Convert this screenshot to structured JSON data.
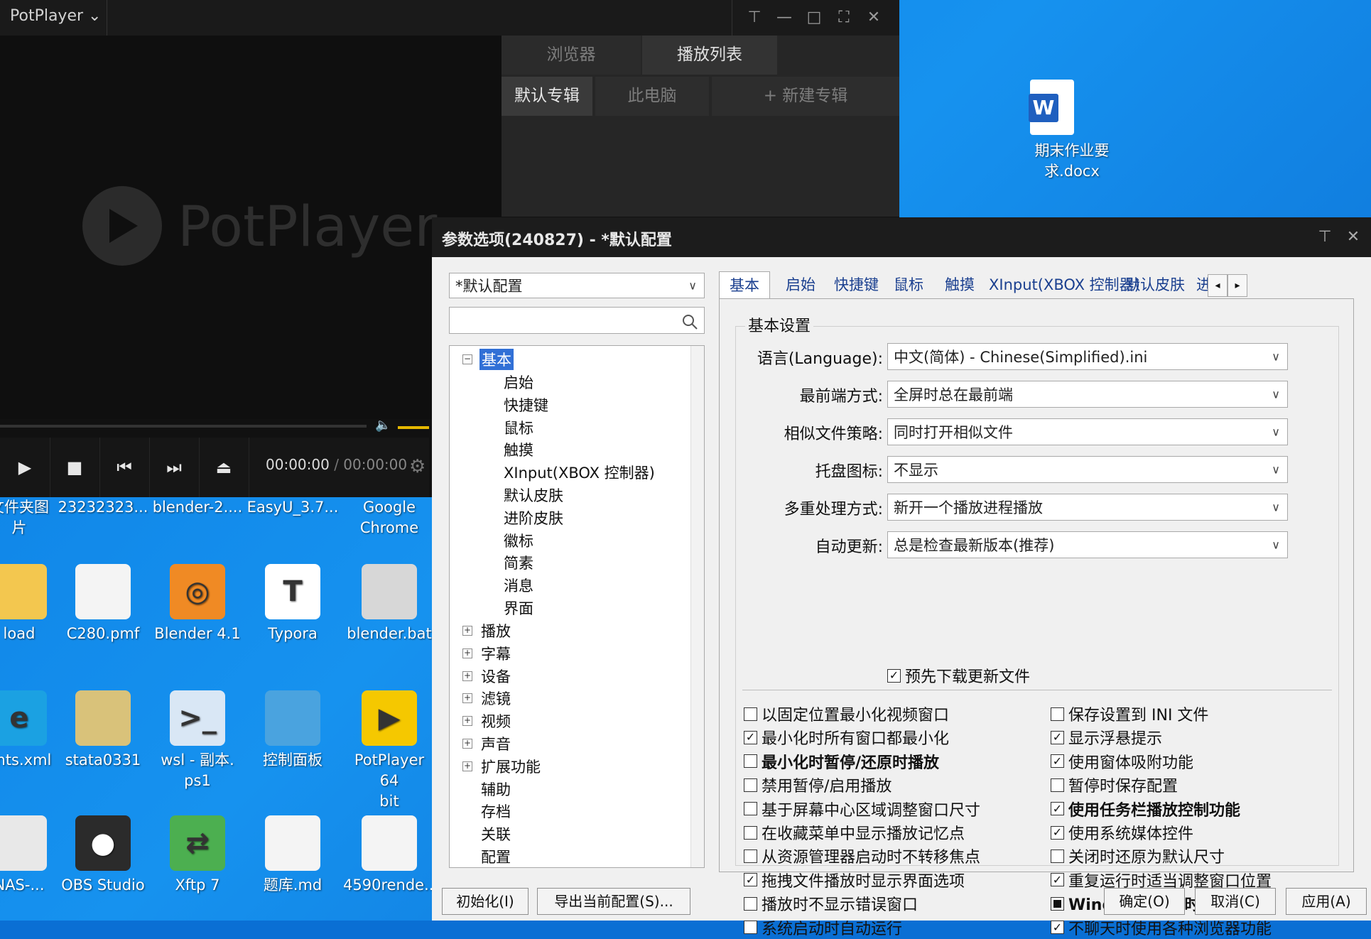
{
  "potplayer": {
    "app_name": "PotPlayer ⌄",
    "window_controls": [
      "⊤",
      "—",
      "□",
      "⛶",
      "✕"
    ],
    "browser_tab": "浏览器",
    "playlist_tab": "播放列表",
    "sub_tabs": [
      "默认专辑",
      "此电脑",
      "+ 新建专辑"
    ],
    "logo_text": "PotPlayer",
    "time_current": "00:00:00",
    "time_sep": "/",
    "time_total": "00:00:00"
  },
  "desktop": {
    "word_file": "期末作业要\n求.docx",
    "icons": [
      {
        "label": "文件夹图\n片",
        "icon": "folder-icon"
      },
      {
        "label": "23232323...",
        "icon": "file-icon"
      },
      {
        "label": "blender-2....",
        "icon": "archive-icon"
      },
      {
        "label": "EasyU_3.7...",
        "icon": "app-icon"
      },
      {
        "label": "Google\nChrome",
        "icon": "chrome-icon"
      },
      {
        "label": "load",
        "icon": "folder-icon"
      },
      {
        "label": "C280.pmf",
        "icon": "file-icon"
      },
      {
        "label": "Blender 4.1",
        "icon": "blender-icon"
      },
      {
        "label": "Typora",
        "icon": "typora-icon"
      },
      {
        "label": "blender.bat",
        "icon": "bat-icon"
      },
      {
        "label": "ents.xml",
        "icon": "edge-icon"
      },
      {
        "label": "stata0331",
        "icon": "archive-icon"
      },
      {
        "label": "wsl - 副本.\nps1",
        "icon": "powershell-icon"
      },
      {
        "label": "控制面板",
        "icon": "control-panel-icon"
      },
      {
        "label": "PotPlayer 64\nbit",
        "icon": "potplayer-icon"
      },
      {
        "label": "NAS-...",
        "icon": "nas-icon"
      },
      {
        "label": "OBS Studio",
        "icon": "obs-icon"
      },
      {
        "label": "Xftp 7",
        "icon": "xftp-icon"
      },
      {
        "label": "题库.md",
        "icon": "file-icon"
      },
      {
        "label": "4590rende...",
        "icon": "file-icon"
      }
    ]
  },
  "dialog": {
    "title": "参数选项(240827) - *默认配置",
    "profile_value": "*默认配置",
    "tree": {
      "root": "基本",
      "children": [
        "启始",
        "快捷键",
        "鼠标",
        "触摸",
        "XInput(XBOX 控制器)",
        "默认皮肤",
        "进阶皮肤",
        "徽标",
        "简素",
        "消息",
        "界面"
      ],
      "sections": [
        "播放",
        "字幕",
        "设备",
        "滤镜",
        "视频",
        "声音",
        "扩展功能",
        "辅助",
        "存档",
        "关联",
        "配置"
      ]
    },
    "tabs": [
      "基本",
      "启始",
      "快捷键",
      "鼠标",
      "触摸",
      "XInput(XBOX 控制器)",
      "默认皮肤",
      "进"
    ],
    "group_title": "基本设置",
    "fields": [
      {
        "label": "语言(Language):",
        "value": "中文(简体) - Chinese(Simplified).ini"
      },
      {
        "label": "最前端方式:",
        "value": "全屏时总在最前端"
      },
      {
        "label": "相似文件策略:",
        "value": "同时打开相似文件"
      },
      {
        "label": "托盘图标:",
        "value": "不显示"
      },
      {
        "label": "多重处理方式:",
        "value": "新开一个播放进程播放"
      },
      {
        "label": "自动更新:",
        "value": "总是检查最新版本(推荐)"
      }
    ],
    "predownload": {
      "label": "预先下载更新文件",
      "checked": true
    },
    "left_checks": [
      {
        "label": "以固定位置最小化视频窗口",
        "checked": false,
        "bold": false
      },
      {
        "label": "最小化时所有窗口都最小化",
        "checked": true,
        "bold": false
      },
      {
        "label": "最小化时暂停/还原时播放",
        "checked": false,
        "bold": true
      },
      {
        "label": "禁用暂停/启用播放",
        "checked": false,
        "bold": false
      },
      {
        "label": "基于屏幕中心区域调整窗口尺寸",
        "checked": false,
        "bold": false
      },
      {
        "label": "在收藏菜单中显示播放记忆点",
        "checked": false,
        "bold": false
      },
      {
        "label": "从资源管理器启动时不转移焦点",
        "checked": false,
        "bold": false
      },
      {
        "label": "拖拽文件播放时显示界面选项",
        "checked": true,
        "bold": false
      },
      {
        "label": "播放时不显示错误窗口",
        "checked": false,
        "bold": false
      },
      {
        "label": "系统启动时自动运行",
        "checked": false,
        "bold": false
      }
    ],
    "right_checks": [
      {
        "label": "保存设置到 INI 文件",
        "state": "unchecked",
        "bold": false
      },
      {
        "label": "显示浮悬提示",
        "state": "checked",
        "bold": false
      },
      {
        "label": "使用窗体吸附功能",
        "state": "checked",
        "bold": false
      },
      {
        "label": "暂停时保存配置",
        "state": "unchecked",
        "bold": false
      },
      {
        "label": "使用任务栏播放控制功能",
        "state": "checked",
        "bold": true
      },
      {
        "label": "使用系统媒体控件",
        "state": "checked",
        "bold": false
      },
      {
        "label": "关闭时还原为默认尺寸",
        "state": "unchecked",
        "bold": false
      },
      {
        "label": "重复运行时适当调整窗口位置",
        "state": "checked",
        "bold": false
      },
      {
        "label": "Windows 锁屏时暂停",
        "state": "indeterminate",
        "bold": true
      },
      {
        "label": "不聊天时使用各种浏览器功能",
        "state": "checked",
        "bold": false
      }
    ],
    "buttons": {
      "init": "初始化(I)",
      "export": "导出当前配置(S)...",
      "ok": "确定(O)",
      "cancel": "取消(C)",
      "apply": "应用(A)"
    }
  }
}
